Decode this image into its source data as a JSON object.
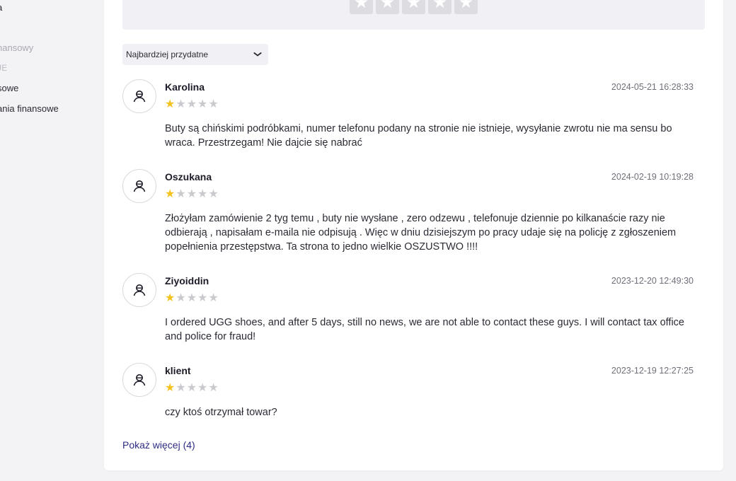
{
  "sidebar": {
    "items": [
      {
        "label": "a"
      },
      {
        "label": "nansowy"
      },
      {
        "label": "JE"
      },
      {
        "label": "sowe"
      },
      {
        "label": "ania finansowe"
      }
    ]
  },
  "rating_panel": {
    "star_glyph": "★",
    "stars": 5
  },
  "sort": {
    "selected": "Najbardziej przydatne",
    "chevron": "⌄"
  },
  "reviews": [
    {
      "author": "Karolina",
      "date": "2024-05-21 16:28:33",
      "rating": 1,
      "text": "Buty są chińskimi podróbkami, numer telefonu podany na stronie nie istnieje, wysyłanie zwrotu nie ma sensu bo wraca. Przestrzegam! Nie dajcie się nabrać"
    },
    {
      "author": "Oszukana",
      "date": "2024-02-19 10:19:28",
      "rating": 1,
      "text": "Złożyłam zamówienie 2 tyg temu , buty nie wysłane , zero odzewu , telefonuje dziennie po kilkanaście razy nie odbierają , napisałam e-maila nie odpisują . Więc w dniu dzisiejszym po pracy udaje się na policję z zgłoszeniem popełnienia przestępstwa. Ta strona to jedno wielkie OSZUSTWO !!!!"
    },
    {
      "author": "Ziyoiddin",
      "date": "2023-12-20 12:49:30",
      "rating": 1,
      "text": "I ordered UGG shoes, and after 5 days, still no news, we are not able to contact these guys. I will contact tax office and police for fraud!"
    },
    {
      "author": "klient",
      "date": "2023-12-19 12:27:25",
      "rating": 1,
      "text": "czy ktoś otrzymał towar?"
    }
  ],
  "show_more": "Pokaż więcej (4)",
  "colors": {
    "star_on": "#f4c21f",
    "star_off": "#c9c9ce",
    "link": "#2f2d86"
  }
}
